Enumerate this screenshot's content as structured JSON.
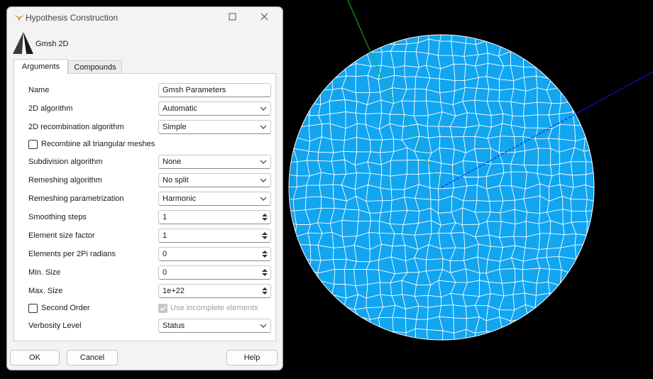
{
  "window": {
    "title": "Hypothesis Construction",
    "close_icon": "close-icon",
    "maximize_icon": "maximize-icon"
  },
  "hypothesis": {
    "name": "Gmsh 2D"
  },
  "tabs": [
    {
      "label": "Arguments",
      "active": true
    },
    {
      "label": "Compounds",
      "active": false
    }
  ],
  "form": {
    "name": {
      "label": "Name",
      "value": "Gmsh Parameters"
    },
    "algo2d": {
      "label": "2D algorithm",
      "value": "Automatic"
    },
    "recomb_algo": {
      "label": "2D recombination algorithm",
      "value": "Simple"
    },
    "recombine_all": {
      "label": "Recombine all triangular meshes",
      "checked": false
    },
    "subdivision": {
      "label": "Subdivision algorithm",
      "value": "None"
    },
    "remeshing": {
      "label": "Remeshing algorithm",
      "value": "No split"
    },
    "remesh_param": {
      "label": "Remeshing parametrization",
      "value": "Harmonic"
    },
    "smoothing": {
      "label": "Smoothing steps",
      "value": "1"
    },
    "size_factor": {
      "label": "Element size factor",
      "value": "1"
    },
    "per_2pi": {
      "label": "Elements per 2Pi radians",
      "value": "0"
    },
    "min_size": {
      "label": "Min. Size",
      "value": "0"
    },
    "max_size": {
      "label": "Max. Size",
      "value": "1e+22"
    },
    "second_order": {
      "label": "Second Order",
      "checked": false
    },
    "incomplete": {
      "label": "Use incomplete elements",
      "checked": true,
      "enabled": false
    },
    "verbosity": {
      "label": "Verbosity Level",
      "value": "Status"
    }
  },
  "buttons": {
    "ok": "OK",
    "cancel": "Cancel",
    "help": "Help"
  },
  "viewport": {
    "background": "#000000",
    "mesh_fill": "#12a5f0",
    "mesh_edge": "#ffffff",
    "axis_x_color": "#1010ee",
    "axis_y_color": "#16c016"
  }
}
